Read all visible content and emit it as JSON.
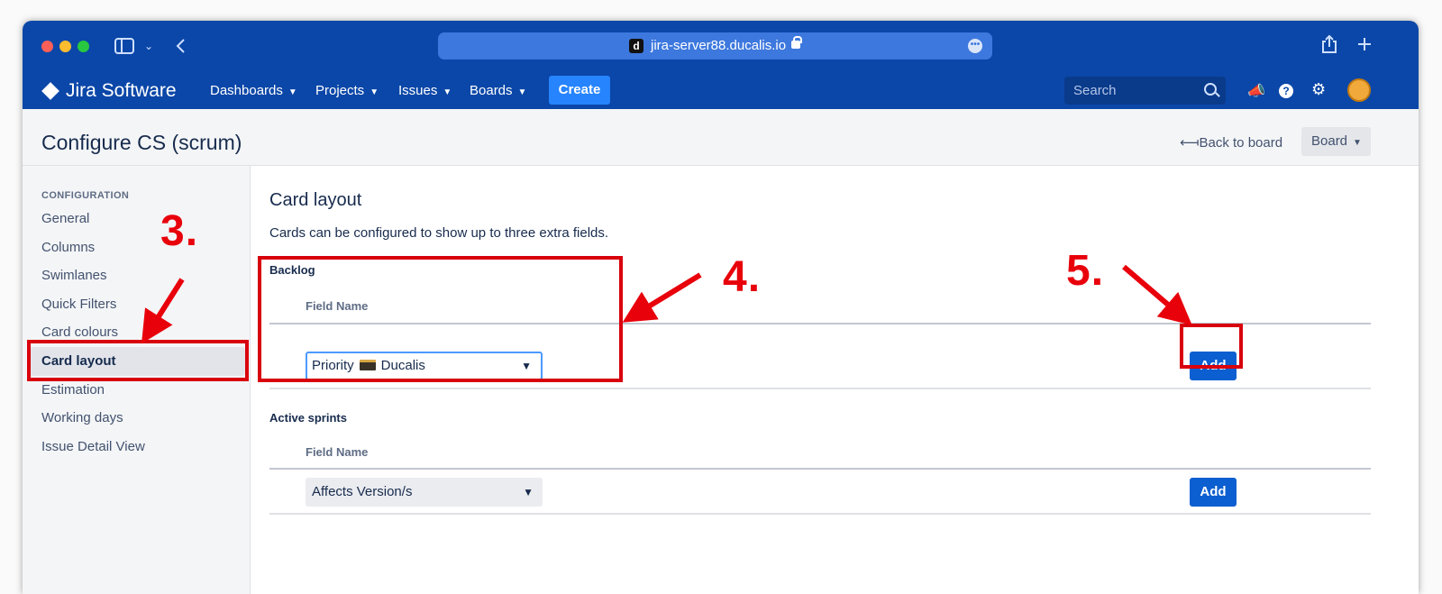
{
  "browser": {
    "url": "jira-server88.ducalis.io",
    "favicon_letter": "d"
  },
  "nav": {
    "logo": "Jira Software",
    "items": [
      "Dashboards",
      "Projects",
      "Issues",
      "Boards"
    ],
    "create_label": "Create",
    "search_placeholder": "Search"
  },
  "page": {
    "title": "Configure CS (scrum)",
    "back_link": "⟻Back to board",
    "board_button": "Board"
  },
  "sidebar": {
    "heading": "CONFIGURATION",
    "items": [
      "General",
      "Columns",
      "Swimlanes",
      "Quick Filters",
      "Card colours",
      "Card layout",
      "Estimation",
      "Working days",
      "Issue Detail View"
    ],
    "active": "Card layout"
  },
  "main": {
    "heading": "Card layout",
    "description": "Cards can be configured to show up to three extra fields.",
    "sections": [
      {
        "label": "Backlog",
        "column_header": "Field Name",
        "field_value_prefix": "Priority",
        "field_value_suffix": "Ducalis",
        "add_label": "Add"
      },
      {
        "label": "Active sprints",
        "column_header": "Field Name",
        "field_value": "Affects Version/s",
        "add_label": "Add"
      }
    ]
  },
  "annotations": {
    "step3": "3.",
    "step4": "4.",
    "step5": "5.",
    "color": "#d9000d"
  }
}
